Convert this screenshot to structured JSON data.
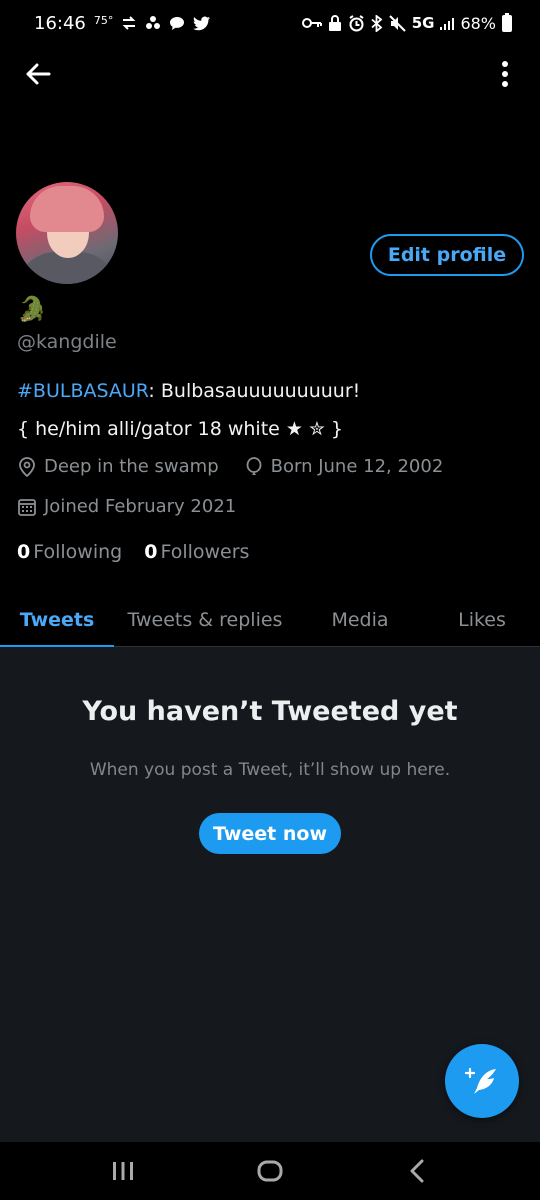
{
  "status_bar": {
    "time": "16:46",
    "temperature": "75°",
    "network": "5G",
    "battery": "68%"
  },
  "profile": {
    "display_name": "🐊",
    "handle": "@kangdile",
    "bio_hashtag": "#BULBASAUR",
    "bio_rest": ": Bulbasauuuuuuuuur!",
    "bio_line2": "{ he/him  alli/gator  18  white  ★  ✮ }",
    "location": "Deep in the swamp",
    "birthday": "Born June 12, 2002",
    "joined": "Joined February 2021",
    "following_count": "0",
    "following_label": "Following",
    "followers_count": "0",
    "followers_label": "Followers",
    "edit_profile_label": "Edit profile"
  },
  "tabs": [
    {
      "label": "Tweets",
      "active": true
    },
    {
      "label": "Tweets & replies",
      "active": false
    },
    {
      "label": "Media",
      "active": false
    },
    {
      "label": "Likes",
      "active": false
    }
  ],
  "empty_state": {
    "title": "You haven’t Tweeted yet",
    "subtitle": "When you post a Tweet, it’ll show up here.",
    "button": "Tweet now"
  },
  "colors": {
    "accent": "#1d9bf0",
    "background": "#000000",
    "panel": "#15181d",
    "muted_text": "#8b9094"
  },
  "icons": {
    "back": "arrow-left-icon",
    "more": "more-vertical-icon",
    "location": "map-pin-icon",
    "birthday": "balloon-icon",
    "joined": "calendar-icon",
    "compose": "compose-feather-icon",
    "nav_recents": "recents-icon",
    "nav_home": "home-icon",
    "nav_back": "nav-back-icon"
  }
}
